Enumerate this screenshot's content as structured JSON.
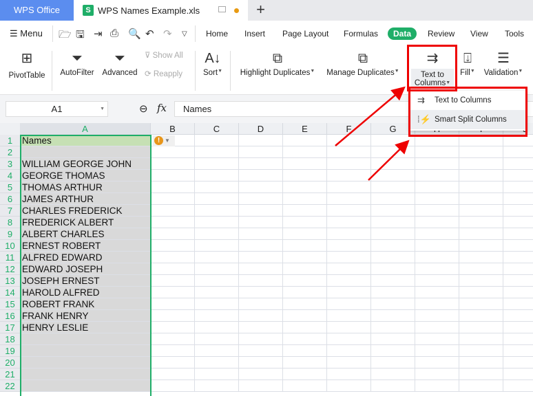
{
  "tabs": {
    "home": "WPS Office",
    "document": "WPS Names Example.xls",
    "doc_icon": "S",
    "new_tab": "+"
  },
  "menu": {
    "label": "Menu",
    "tabs": [
      "Home",
      "Insert",
      "Page Layout",
      "Formulas",
      "Data",
      "Review",
      "View",
      "Tools"
    ],
    "active": "Data"
  },
  "ribbon": {
    "pivot": "PivotTable",
    "autofilter": "AutoFilter",
    "advanced": "Advanced",
    "show_all": "Show All",
    "reapply": "Reapply",
    "sort": "Sort",
    "highlight": "Highlight Duplicates",
    "manage": "Manage Duplicates",
    "ttc1": "Text to",
    "ttc2": "Columns",
    "fill": "Fill",
    "validation": "Validation"
  },
  "dropdown": {
    "items": [
      "Text to Columns",
      "Smart Split Columns"
    ]
  },
  "formula_bar": {
    "cell_ref": "A1",
    "fx": "fx",
    "value": "Names"
  },
  "sheet": {
    "columns": [
      "A",
      "B",
      "C",
      "D",
      "E",
      "F",
      "G",
      "H",
      "I",
      "J"
    ],
    "rows": [
      "Names",
      "",
      "WILLIAM GEORGE JOHN",
      "GEORGE THOMAS",
      "THOMAS ARTHUR",
      "JAMES ARTHUR",
      "CHARLES FREDERICK",
      "FREDERICK ALBERT",
      "ALBERT CHARLES",
      "ERNEST ROBERT",
      "ALFRED EDWARD",
      "EDWARD JOSEPH",
      "JOSEPH ERNEST",
      "HAROLD ALFRED",
      "ROBERT FRANK",
      "FRANK HENRY",
      "HENRY LESLIE",
      "",
      "",
      "",
      "",
      ""
    ]
  },
  "colors": {
    "accent": "#1fae68",
    "annotation": "#e00000",
    "header_cell": "#c6e0b4",
    "selected_col": "#d9d9d9"
  }
}
